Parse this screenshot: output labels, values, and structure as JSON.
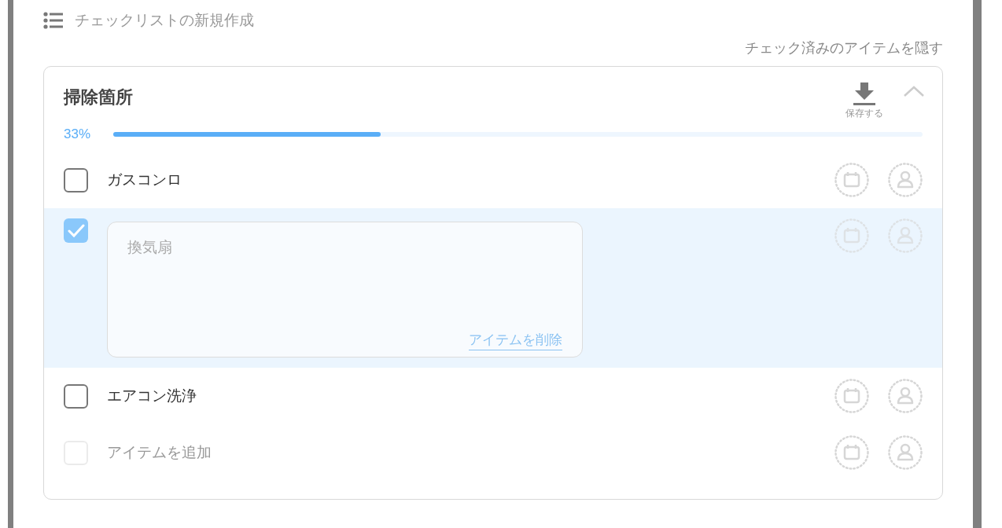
{
  "heading": {
    "title": "チェックリストの新規作成"
  },
  "hide_checked_link": "チェック済みのアイテムを隠す",
  "checklist": {
    "title": "掃除箇所",
    "save_label": "保存する",
    "expanded": true,
    "progress": {
      "label": "33%",
      "level": 0.33
    },
    "items": [
      {
        "kind": "item",
        "label": "ガスコンロ",
        "checked": false,
        "expanded": false
      },
      {
        "kind": "item",
        "label": "換気扇",
        "checked": true,
        "expanded": true,
        "delete_link": "アイテムを削除"
      },
      {
        "kind": "item",
        "label": "エアコン洗浄",
        "checked": false,
        "expanded": false
      },
      {
        "kind": "add",
        "placeholder": "アイテムを追加",
        "checked": false,
        "disabled": true
      }
    ]
  }
}
